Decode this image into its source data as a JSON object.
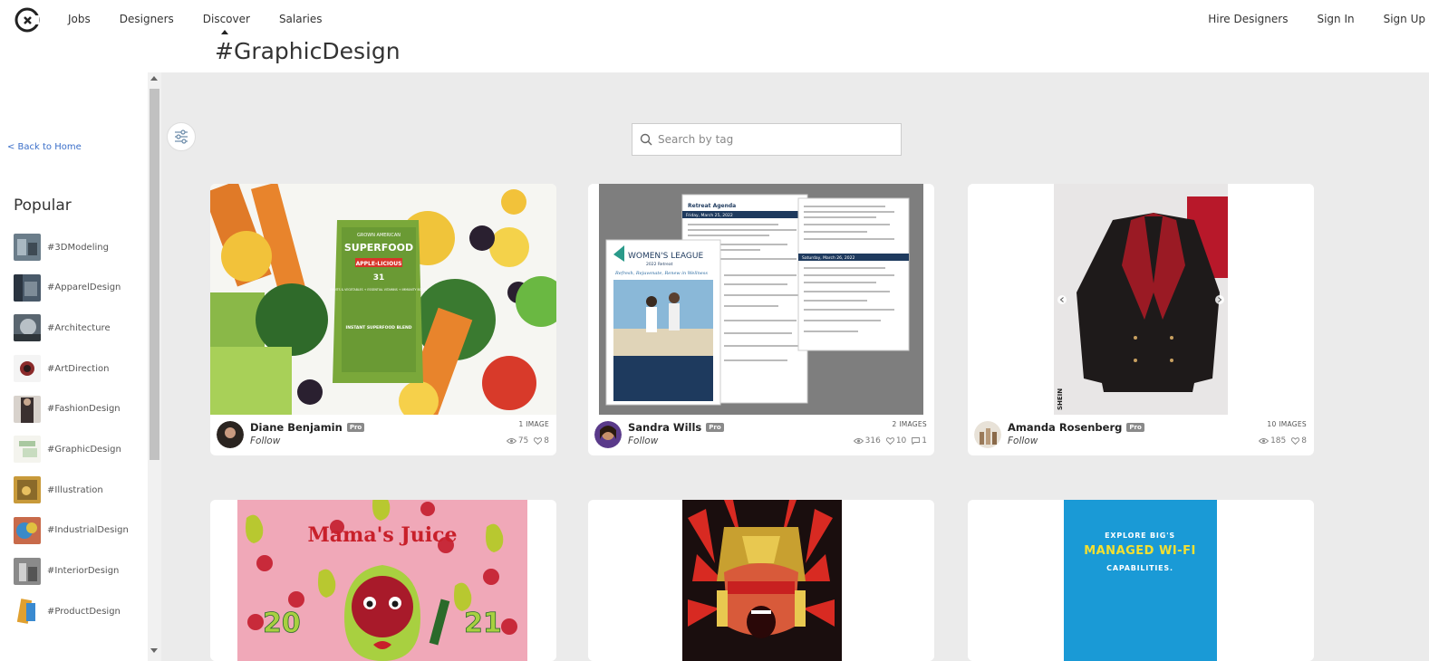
{
  "nav": {
    "left": [
      "Jobs",
      "Designers",
      "Discover",
      "Salaries"
    ],
    "right": [
      "Hire Designers",
      "Sign In",
      "Sign Up"
    ]
  },
  "page_title": "#GraphicDesign",
  "sidebar": {
    "back_link": "< Back to Home",
    "popular_heading": "Popular",
    "tags": [
      {
        "label": "#3DModeling",
        "color": "#6b7d8a"
      },
      {
        "label": "#ApparelDesign",
        "color": "#4a5a6a"
      },
      {
        "label": "#Architecture",
        "color": "#5a6670"
      },
      {
        "label": "#ArtDirection",
        "color": "#8a2a2a"
      },
      {
        "label": "#FashionDesign",
        "color": "#3a3030"
      },
      {
        "label": "#GraphicDesign",
        "color": "#a9c8a0"
      },
      {
        "label": "#Illustration",
        "color": "#c89a3a"
      },
      {
        "label": "#IndustrialDesign",
        "color": "#c86a4a"
      },
      {
        "label": "#InteriorDesign",
        "color": "#8a8a8a"
      },
      {
        "label": "#ProductDesign",
        "color": "#e0a030"
      }
    ]
  },
  "search": {
    "placeholder": "Search by tag"
  },
  "cards": [
    {
      "author": "Diane Benjamin",
      "pro": "Pro",
      "follow": "Follow",
      "images": "1 IMAGE",
      "views": "75",
      "likes": "8",
      "comments": ""
    },
    {
      "author": "Sandra Wills",
      "pro": "Pro",
      "follow": "Follow",
      "images": "2 IMAGES",
      "views": "316",
      "likes": "10",
      "comments": "1"
    },
    {
      "author": "Amanda Rosenberg",
      "pro": "Pro",
      "follow": "Follow",
      "images": "10 IMAGES",
      "views": "185",
      "likes": "8",
      "comments": ""
    }
  ],
  "card_art": {
    "superfood_brand": "GROWN AMERICAN",
    "superfood_title": "SUPERFOOD",
    "superfood_flavor": "APPLE-LICIOUS",
    "superfood_count": "31",
    "superfood_desc": "FRUITS & VEGETABLES + ESSENTIAL VITAMINS + IMMUNITY BOOST",
    "superfood_instant": "INSTANT SUPERFOOD BLEND",
    "agenda_title": "Retreat Agenda",
    "agenda_day1": "Friday, March 25, 2022",
    "agenda_day2": "Saturday, March 26, 2022",
    "league_title": "WOMEN'S LEAGUE",
    "league_sub": "2022 Retreat",
    "league_tag": "Refresh, Rejuvenate, Renew in Wellness",
    "juice_title": "Mama's Juice",
    "juice_y1": "20",
    "juice_y2": "21",
    "wifi_line1": "EXPLORE BIG'S",
    "wifi_line2": "MANAGED WI-FI",
    "wifi_line3": "CAPABILITIES.",
    "shein": "SHEIN"
  },
  "colors": {
    "accent_link": "#3b6fc9",
    "background": "#ebebeb",
    "wifi_blue": "#1a9ad6",
    "juice_pink": "#f0a8b8"
  }
}
